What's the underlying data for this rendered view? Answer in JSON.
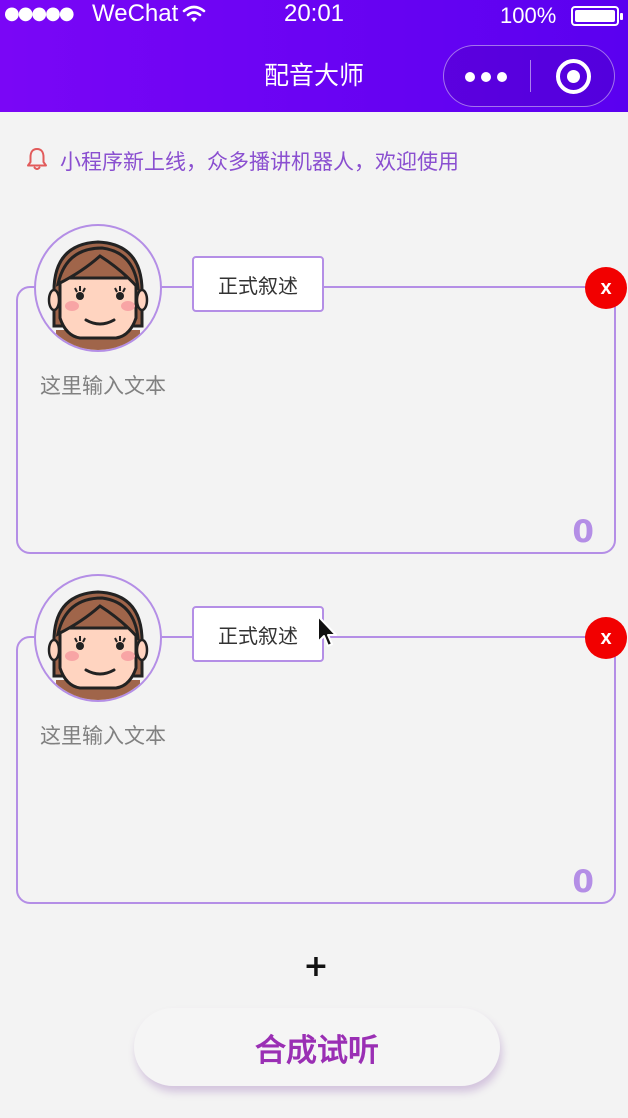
{
  "status_bar": {
    "signal": "●●●●●",
    "carrier": "WeChat",
    "time": "20:01",
    "battery": "100%"
  },
  "nav": {
    "title": "配音大师",
    "more_icon": "more-dots-icon",
    "close_icon": "target-circle-icon"
  },
  "notice": {
    "icon": "bell-icon",
    "text": "小程序新上线，众多播讲机器人，欢迎使用"
  },
  "cards": [
    {
      "voice_style": "正式叙述",
      "text_placeholder": "这里输入文本",
      "char_count": "0",
      "delete_label": "x"
    },
    {
      "voice_style": "正式叙述",
      "text_placeholder": "这里输入文本",
      "char_count": "0",
      "delete_label": "x"
    }
  ],
  "add_button": "+",
  "synth_button": "合成试听",
  "colors": {
    "header_gradient_start": "#7a06f6",
    "header_gradient_end": "#5a00f0",
    "accent_purple": "#b48ee6",
    "notice_text": "#8a4fd0",
    "delete_red": "#f20000",
    "synth_text": "#9a2fb4"
  }
}
